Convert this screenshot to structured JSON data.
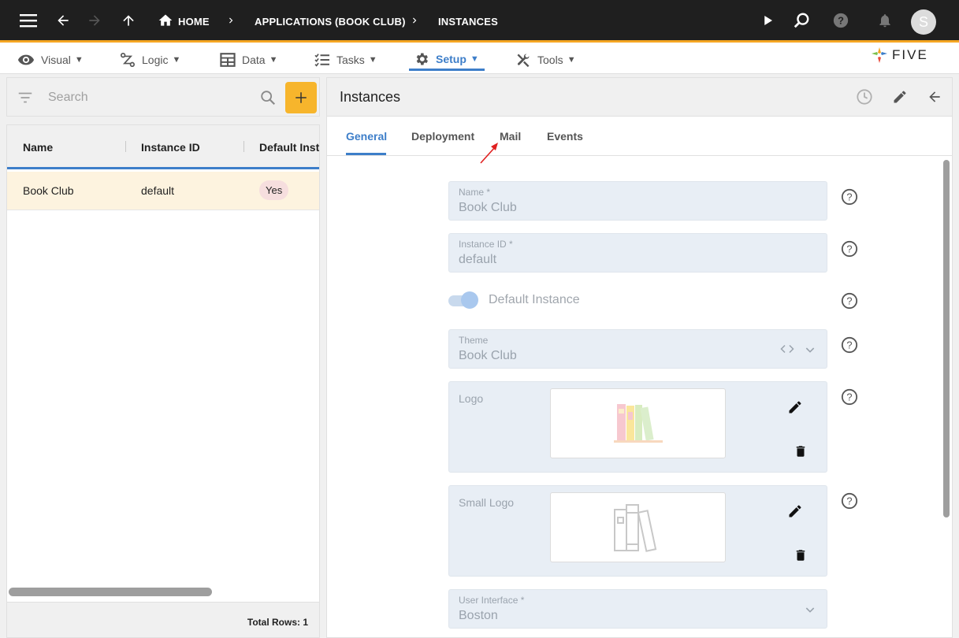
{
  "topbar": {
    "breadcrumbs": [
      "HOME",
      "APPLICATIONS (BOOK CLUB)",
      "INSTANCES"
    ],
    "avatar_initial": "S",
    "accent_color": "#f5a623"
  },
  "menubar": {
    "items": [
      {
        "label": "Visual",
        "icon": "eye-icon"
      },
      {
        "label": "Logic",
        "icon": "logic-icon"
      },
      {
        "label": "Data",
        "icon": "table-icon"
      },
      {
        "label": "Tasks",
        "icon": "checklist-icon"
      },
      {
        "label": "Setup",
        "icon": "gear-icon",
        "active": true
      },
      {
        "label": "Tools",
        "icon": "tools-icon"
      }
    ],
    "logo_text": "FIVE"
  },
  "list": {
    "search_placeholder": "Search",
    "columns": [
      "Name",
      "Instance ID",
      "Default Instance"
    ],
    "rows": [
      {
        "name": "Book Club",
        "instance_id": "default",
        "default_instance": "Yes"
      }
    ],
    "total_rows_label": "Total Rows: 1"
  },
  "detail": {
    "title": "Instances",
    "tabs": [
      "General",
      "Deployment",
      "Mail",
      "Events"
    ],
    "active_tab": "General",
    "fields": {
      "name": {
        "label": "Name *",
        "value": "Book Club"
      },
      "instance_id": {
        "label": "Instance ID *",
        "value": "default"
      },
      "default_instance": {
        "label": "Default Instance",
        "checked": true
      },
      "theme": {
        "label": "Theme",
        "value": "Book Club"
      },
      "logo": {
        "label": "Logo"
      },
      "small_logo": {
        "label": "Small Logo"
      },
      "user_interface": {
        "label": "User Interface *",
        "value": "Boston"
      }
    }
  },
  "colors": {
    "accent_blue": "#3d7ec9",
    "add_button": "#f7b52c",
    "selected_row": "#fdf3df",
    "field_bg": "#e8eef5"
  }
}
